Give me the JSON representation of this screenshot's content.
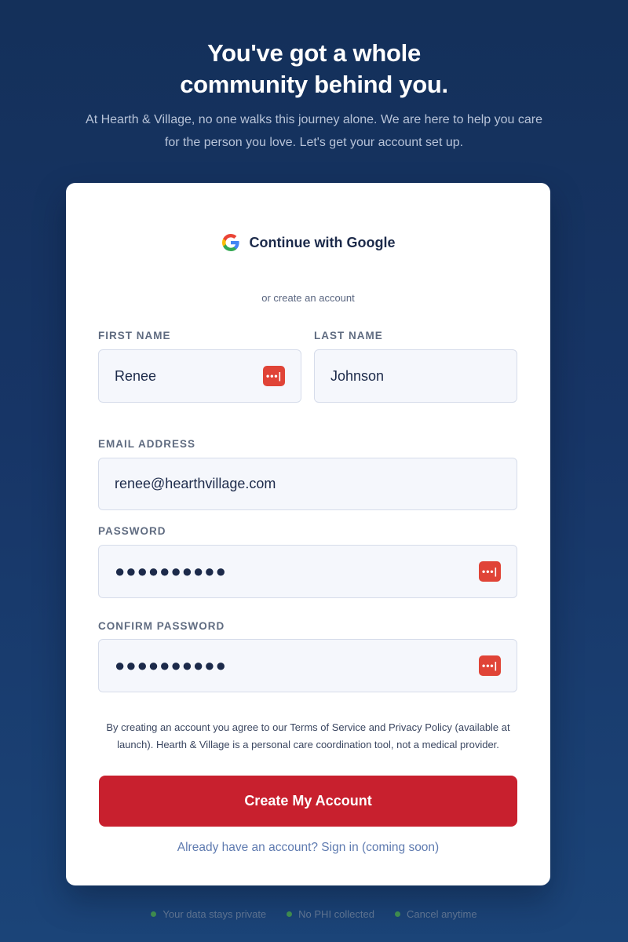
{
  "hero": {
    "title_line1": "You've got a whole",
    "title_line2": "community behind you.",
    "subtitle": "At Hearth & Village, no one walks this journey alone. We are here to help you care for the person you love. Let's get your account set up."
  },
  "card": {
    "google_label": "Continue with Google",
    "divider_text": "or create an account",
    "first_name": {
      "label": "FIRST NAME",
      "value": "Renee"
    },
    "last_name": {
      "label": "LAST NAME",
      "value": "Johnson"
    },
    "email": {
      "label": "EMAIL ADDRESS",
      "value": "renee@hearthvillage.com"
    },
    "password": {
      "label": "PASSWORD",
      "masked": "●●●●●●●●●●"
    },
    "confirm_password": {
      "label": "CONFIRM PASSWORD",
      "masked": "●●●●●●●●●●"
    },
    "legal": "By creating an account you agree to our Terms of Service and Privacy Policy (available at launch). Hearth & Village is a personal care coordination tool, not a medical provider.",
    "cta_label": "Create My Account",
    "signin_label": "Already have an account? Sign in (coming soon)"
  },
  "footer": {
    "items": [
      "Your data stays private",
      "No PHI collected",
      "Cancel anytime"
    ]
  },
  "colors": {
    "accent": "#c8202e",
    "password_icon": "#e04437",
    "status_green": "#3e8a4e"
  },
  "icons": {
    "google": "google-icon",
    "password_manager": "password-manager-icon",
    "footer_bullet": "status-dot-icon"
  }
}
